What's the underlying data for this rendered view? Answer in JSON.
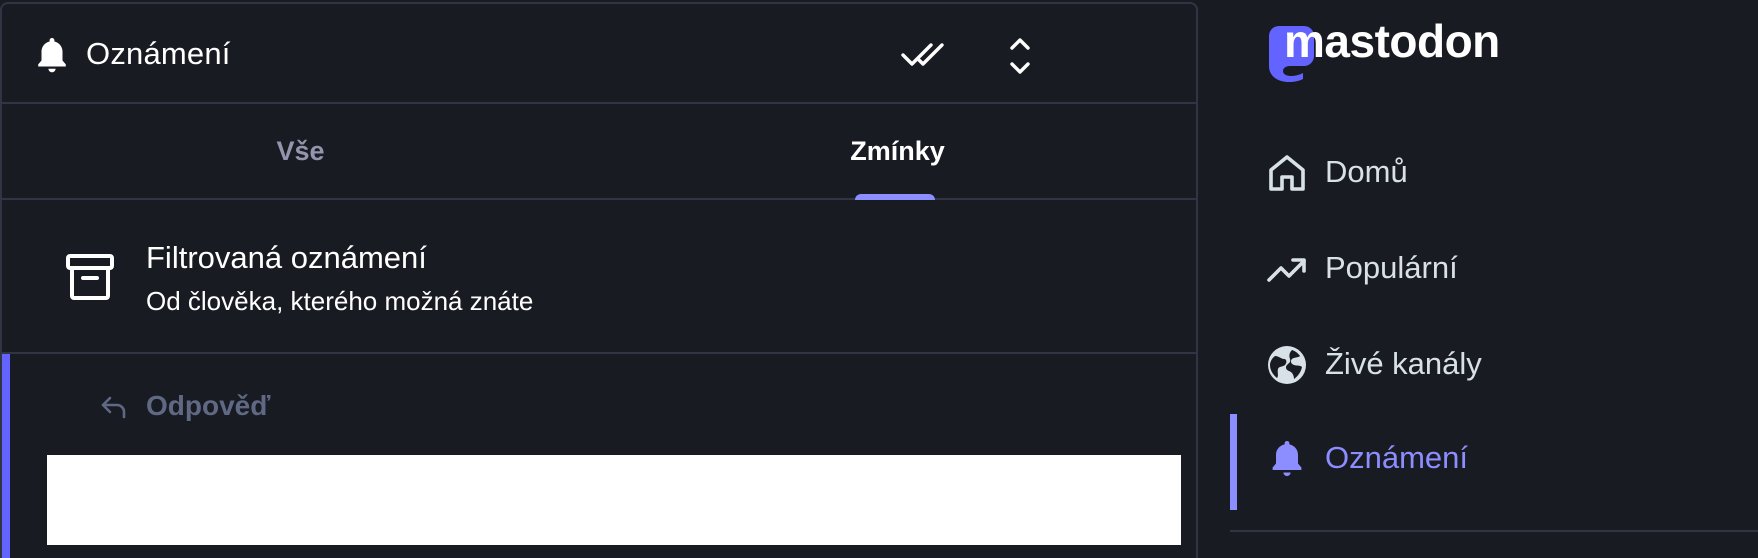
{
  "column": {
    "title": "Oznámení",
    "title_icon": "bell-icon",
    "mark_read_icon": "double-check-icon",
    "settings_icon": "chevron-up-down-icon"
  },
  "tabs": [
    {
      "label": "Vše",
      "active": false
    },
    {
      "label": "Zmínky",
      "active": true
    }
  ],
  "filtered": {
    "icon": "archive-icon",
    "title": "Filtrovaná oznámení",
    "subtitle": "Od člověka, kterého možná znáte"
  },
  "notification": {
    "icon": "reply-icon",
    "label": "Odpověď"
  },
  "sidebar": {
    "logo": "mastodon",
    "items": [
      {
        "label": "Domů",
        "icon": "home-icon",
        "active": false
      },
      {
        "label": "Populární",
        "icon": "trending-icon",
        "active": false
      },
      {
        "label": "Živé kanály",
        "icon": "globe-icon",
        "active": false
      },
      {
        "label": "Oznámení",
        "icon": "bell-icon",
        "active": true
      }
    ]
  },
  "colors": {
    "background": "#191b22",
    "border": "#313543",
    "accent": "#8c8dff",
    "muted": "#9295ad"
  }
}
